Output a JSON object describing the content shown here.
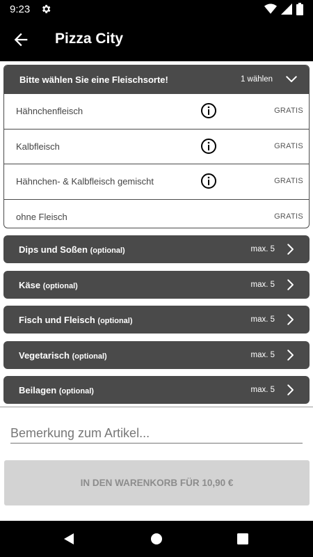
{
  "status": {
    "time": "9:23",
    "icons": [
      "gear-icon",
      "wifi-icon",
      "signal-icon",
      "battery-icon"
    ]
  },
  "appbar": {
    "title": "Pizza City",
    "back_icon": "arrow-left-icon"
  },
  "meat_group": {
    "title": "Bitte wählen Sie eine Fleischsorte!",
    "count": "1 wählen",
    "options": [
      {
        "label": "Hähnchenfleisch",
        "price": "GRATIS",
        "info": true
      },
      {
        "label": "Kalbfleisch",
        "price": "GRATIS",
        "info": true
      },
      {
        "label": "Hähnchen- & Kalbfleisch gemischt",
        "price": "GRATIS",
        "info": true
      },
      {
        "label": "ohne Fleisch",
        "price": "GRATIS",
        "info": false
      }
    ]
  },
  "groups": [
    {
      "title": "Dips und Soßen",
      "optional": "(optional)",
      "max": "max. 5"
    },
    {
      "title": "Käse",
      "optional": "(optional)",
      "max": "max. 5"
    },
    {
      "title": "Fisch und Fleisch",
      "optional": "(optional)",
      "max": "max. 5"
    },
    {
      "title": "Vegetarisch",
      "optional": "(optional)",
      "max": "max. 5"
    },
    {
      "title": "Beilagen",
      "optional": "(optional)",
      "max": "max. 5"
    }
  ],
  "remark": {
    "placeholder": "Bemerkung zum Artikel...",
    "value": ""
  },
  "cart": {
    "label": "IN DEN WARENKORB FÜR 10,90 €"
  },
  "colors": {
    "header": "#000000",
    "group": "#4a4a4a",
    "button_disabled": "#d3d3d3"
  }
}
